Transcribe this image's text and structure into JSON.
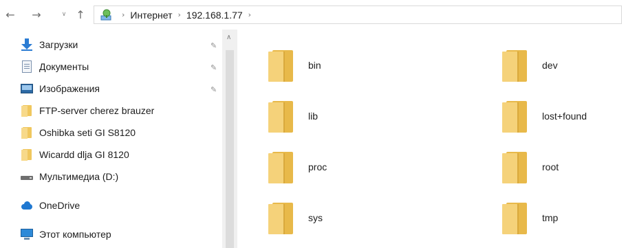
{
  "address_bar": {
    "crumbs": [
      "Интернет",
      "192.168.1.77"
    ]
  },
  "icons": {
    "back": "arrow-left-icon",
    "forward": "arrow-right-icon",
    "recent": "chevron-down-icon",
    "up": "arrow-up-icon",
    "location": "network-location-icon",
    "pin": "pin-icon"
  },
  "sidebar": {
    "items": [
      {
        "label": "Загрузки",
        "icon": "download-icon",
        "pinned": true
      },
      {
        "label": "Документы",
        "icon": "documents-icon",
        "pinned": true
      },
      {
        "label": "Изображения",
        "icon": "images-icon",
        "pinned": true
      },
      {
        "label": "FTP-server cherez brauzer",
        "icon": "folder-icon",
        "pinned": false
      },
      {
        "label": "Oshibka seti GI S8120",
        "icon": "folder-icon",
        "pinned": false
      },
      {
        "label": "Wicardd dlja GI 8120",
        "icon": "folder-icon",
        "pinned": false
      },
      {
        "label": "Мультимедиа (D:)",
        "icon": "drive-icon",
        "pinned": false
      },
      {
        "label": "OneDrive",
        "icon": "onedrive-icon",
        "pinned": false
      },
      {
        "label": "Этот компьютер",
        "icon": "this-pc-icon",
        "pinned": false
      }
    ]
  },
  "main": {
    "folders": [
      {
        "name": "bin"
      },
      {
        "name": "dev"
      },
      {
        "name": "lib"
      },
      {
        "name": "lost+found"
      },
      {
        "name": "proc"
      },
      {
        "name": "root"
      },
      {
        "name": "sys"
      },
      {
        "name": "tmp"
      }
    ]
  },
  "colors": {
    "folder": "#f5d27a",
    "accent": "#2b7cd3"
  }
}
